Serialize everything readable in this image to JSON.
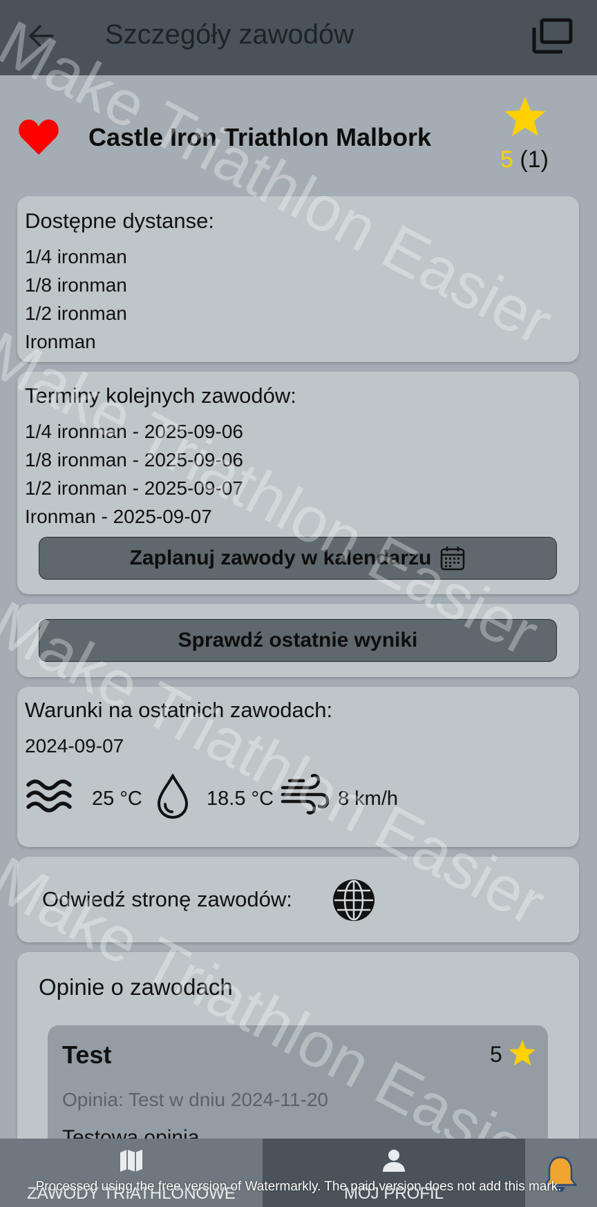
{
  "topbar": {
    "title": "Szczegóły zawodów"
  },
  "race": {
    "name": "Castle Iron Triathlon Malbork",
    "rating_value": "5",
    "rating_count": "(1)"
  },
  "distances": {
    "title": "Dostępne dystanse:",
    "items": [
      "1/4 ironman",
      "1/8 ironman",
      "1/2 ironman",
      "Ironman"
    ]
  },
  "upcoming": {
    "title": "Terminy kolejnych zawodów:",
    "items": [
      "1/4 ironman - 2025-09-06",
      "1/8 ironman - 2025-09-06",
      "1/2 ironman - 2025-09-07",
      "Ironman - 2025-09-07"
    ],
    "calendar_button": "Zaplanuj zawody w kalendarzu"
  },
  "results": {
    "button": "Sprawdź ostatnie wyniki"
  },
  "weather": {
    "title": "Warunki na ostatnich zawodach:",
    "date": "2024-09-07",
    "water_temp": "25 °C",
    "air_temp": "18.5 °C",
    "wind": "8 km/h"
  },
  "website": {
    "label": "Odwiedź stronę zawodów:"
  },
  "reviews": {
    "title": "Opinie o zawodach",
    "items": [
      {
        "author": "Test",
        "score": "5",
        "meta": "Opinia: Test w dniu 2024-11-20",
        "text": "Testowa opinia"
      }
    ]
  },
  "bottom_nav": {
    "left_label": "ZAWODY TRIATHLONOWE",
    "right_label": "MÓJ PROFIL"
  },
  "overlay": {
    "watermark_text": "Make Triathlon Easier",
    "notice": "Processed using the free version of Watermarkly. The paid version does not add this mark."
  },
  "colors": {
    "topbar": "#4a535a",
    "background": "#a4adb3",
    "card": "#bfc6ca",
    "button": "#5e686d",
    "heart": "#ff0000",
    "star": "#ffd100"
  },
  "icons": [
    "arrow-left-icon",
    "windows-icon",
    "heart-icon",
    "star-icon",
    "calendar-icon",
    "waves-icon",
    "droplet-icon",
    "wind-icon",
    "globe-icon",
    "map-icon",
    "person-icon",
    "bell-icon"
  ]
}
